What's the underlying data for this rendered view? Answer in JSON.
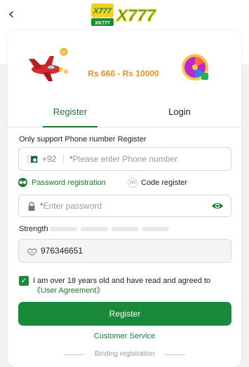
{
  "header": {
    "back_icon": "chevron-left-icon",
    "logo_text_main": "X777",
    "logo_text_small": "X777",
    "logo_text_sub": "XK777"
  },
  "banner": {
    "amount_text": "Rs 666 - Rs 10000",
    "icons": [
      "airplane-icon",
      "coin-icon",
      "spin-wheel-icon"
    ]
  },
  "tabs": [
    {
      "label": "Register",
      "active": true
    },
    {
      "label": "Login",
      "active": false
    }
  ],
  "phone_section": {
    "hint": "Only support Phone number Register",
    "flag_icon": "pakistan-flag-icon",
    "country_code": "+92",
    "required_mark": "*",
    "placeholder": "Please enter Phone number"
  },
  "modes": {
    "password": "Password registration",
    "code": "Code register",
    "code_icon_text": "123"
  },
  "password": {
    "required_mark": "*",
    "placeholder": "Enter password"
  },
  "strength": {
    "label": "Strength",
    "level": 0
  },
  "invite": {
    "value": "976346651"
  },
  "agreement": {
    "checked": true,
    "text": "I am over 18 years old and have read and agreed to ",
    "link": "《User Agreement》"
  },
  "buttons": {
    "register": "Register"
  },
  "footer": {
    "service": "Customer Service",
    "binding": "Binding registration"
  },
  "colors": {
    "accent": "#1a7a2e",
    "button": "#188a38",
    "required": "#e23b3b"
  }
}
